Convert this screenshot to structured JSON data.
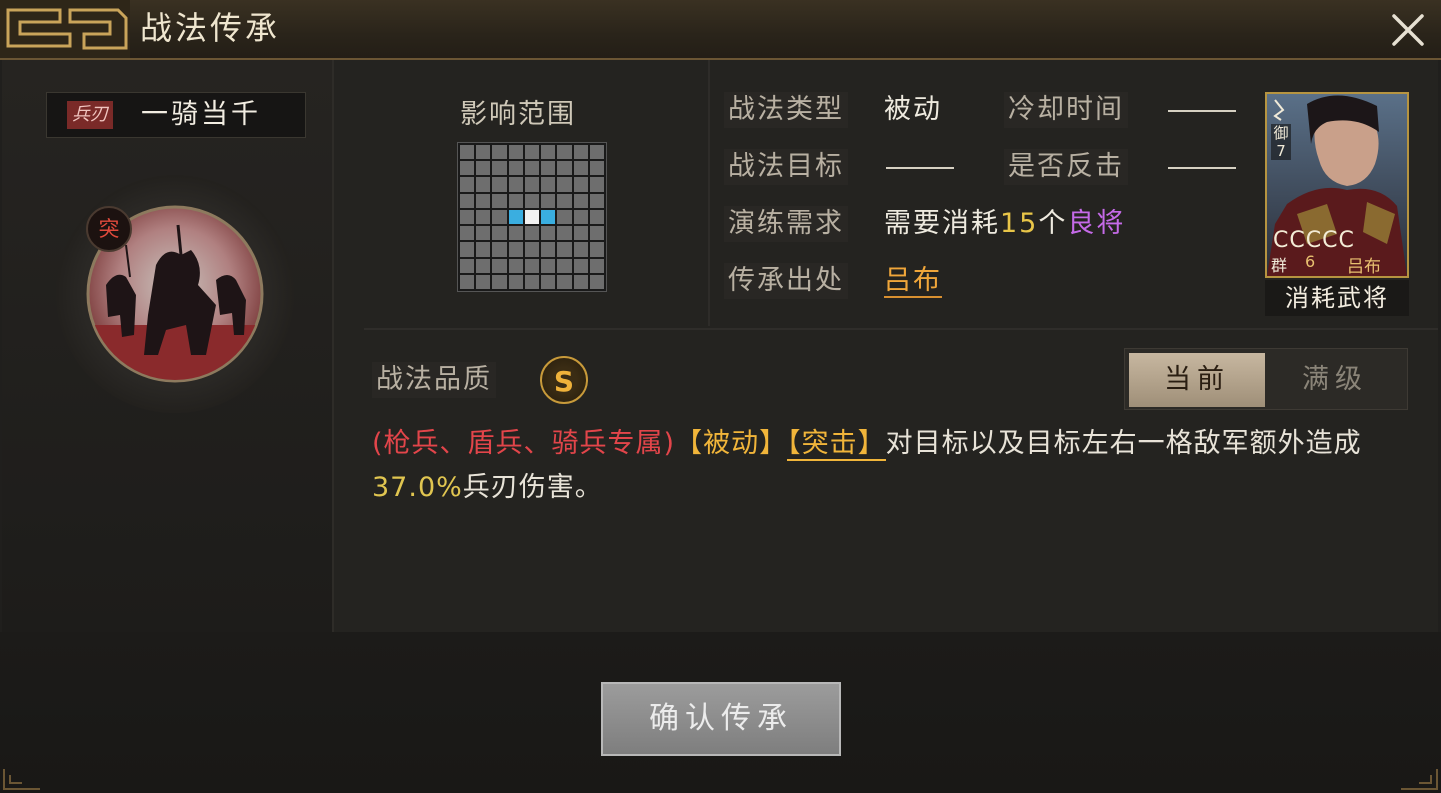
{
  "window": {
    "title": "战法传承"
  },
  "skill": {
    "type_tag": "兵刃",
    "name": "一骑当千",
    "tuji_badge": "突"
  },
  "range": {
    "label": "影响范围",
    "grid_size": 9,
    "highlight_cells": [
      [
        4,
        3
      ],
      [
        4,
        5
      ]
    ],
    "self_cell": [
      4,
      4
    ]
  },
  "info": {
    "type_label": "战法类型",
    "type_value": "被动",
    "cooldown_label": "冷却时间",
    "target_label": "战法目标",
    "counter_label": "是否反击",
    "drill_label": "演练需求",
    "drill_prefix": "需要消耗",
    "drill_count": "15",
    "drill_unit": "个",
    "drill_item": "良将",
    "source_label": "传承出处",
    "source_value": "吕布"
  },
  "card": {
    "badge": "御7",
    "stars": "CCCCC",
    "faction": "群",
    "cost": "6",
    "name": "吕布",
    "caption": "消耗武将"
  },
  "quality": {
    "label": "战法品质",
    "grade": "S"
  },
  "toggle": {
    "current": "当前",
    "max": "满级"
  },
  "description": {
    "restriction": "(枪兵、盾兵、骑兵专属)",
    "tag_passive": "【被动】",
    "tag_charge": "【突击】",
    "text1": "对目标以及目标左右一格敌军额外造成",
    "percent": "37.0%",
    "text2": "兵刃伤害。"
  },
  "actions": {
    "confirm": "确认传承"
  },
  "colors": {
    "accent_gold": "#f1b53a",
    "restriction_red": "#e2454a",
    "grid_highlight": "#3aaee0",
    "drill_purple": "#c56ae8"
  }
}
